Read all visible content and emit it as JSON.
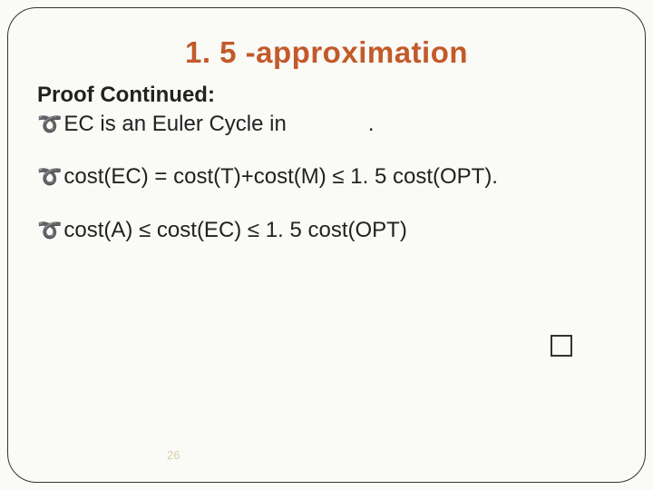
{
  "title": "1. 5 -approximation",
  "subhead": "Proof Continued:",
  "lines": {
    "l1_a": "EC is an Euler Cycle in",
    "l1_b": ".",
    "l2": "cost(EC) = cost(T)+cost(M) ≤ 1. 5 cost(OPT).",
    "l3": "cost(A) ≤ cost(EC) ≤ 1. 5 cost(OPT)"
  },
  "pagenum": "26"
}
